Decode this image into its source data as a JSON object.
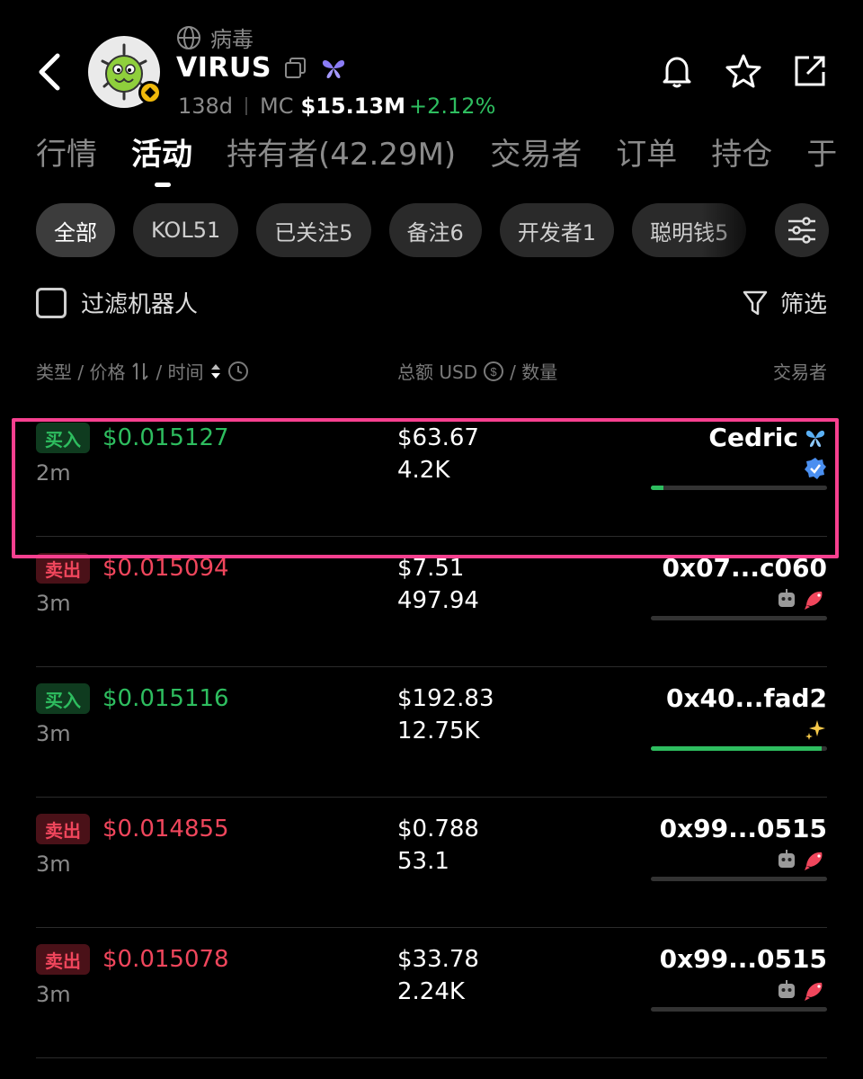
{
  "token": {
    "subname": "病毒",
    "name": "VIRUS",
    "age": "138d",
    "mc_label": "MC",
    "mc_value": "$15.13M",
    "mc_change": "+2.12%"
  },
  "tabs": [
    "行情",
    "活动",
    "持有者(42.29M)",
    "交易者",
    "订单",
    "持仓",
    "于"
  ],
  "chips": [
    "全部",
    "KOL51",
    "已关注5",
    "备注6",
    "开发者1",
    "聪明钱5"
  ],
  "filters": {
    "bot_label": "过滤机器人",
    "sift_label": "筛选"
  },
  "columns": {
    "type_price_time": "类型 / 价格",
    "time": "/ 时间",
    "amount": "总额 USD",
    "qty": "/ 数量",
    "trader": "交易者"
  },
  "rows": [
    {
      "type": "买入",
      "side": "buy",
      "price": "$0.015127",
      "age": "2m",
      "usd": "$63.67",
      "qty": "4.2K",
      "trader": "Cedric",
      "bar": 0.07
    },
    {
      "type": "卖出",
      "side": "sell",
      "price": "$0.015094",
      "age": "3m",
      "usd": "$7.51",
      "qty": "497.94",
      "trader": "0x07...c060",
      "bar": 0
    },
    {
      "type": "买入",
      "side": "buy",
      "price": "$0.015116",
      "age": "3m",
      "usd": "$192.83",
      "qty": "12.75K",
      "trader": "0x40...fad2",
      "bar": 0.97
    },
    {
      "type": "卖出",
      "side": "sell",
      "price": "$0.014855",
      "age": "3m",
      "usd": "$0.788",
      "qty": "53.1",
      "trader": "0x99...0515",
      "bar": 0
    },
    {
      "type": "卖出",
      "side": "sell",
      "price": "$0.015078",
      "age": "3m",
      "usd": "$33.78",
      "qty": "2.24K",
      "trader": "0x99...0515",
      "bar": 0
    }
  ],
  "colors": {
    "buy": "#2ebd5f",
    "sell": "#f0465c",
    "highlight": "#f7408f"
  }
}
